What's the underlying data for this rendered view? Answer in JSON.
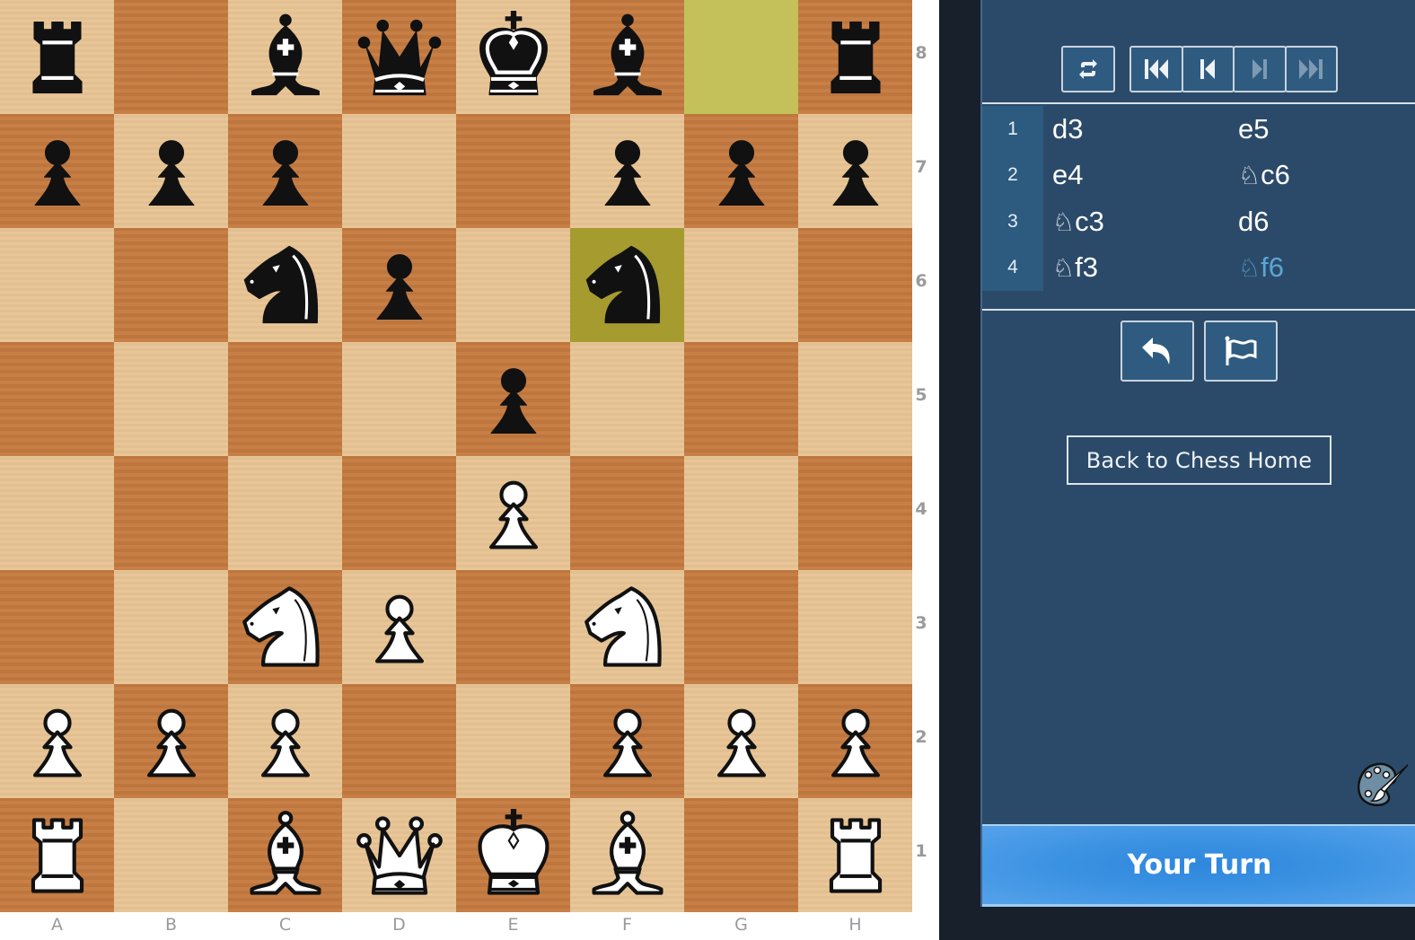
{
  "board": {
    "orientation": "white-bottom",
    "files": [
      "A",
      "B",
      "C",
      "D",
      "E",
      "F",
      "G",
      "H"
    ],
    "ranks": [
      "8",
      "7",
      "6",
      "5",
      "4",
      "3",
      "2",
      "1"
    ],
    "colors": {
      "light": "#e7c393",
      "dark": "#c57b40",
      "highlight_light": "#c4c15b",
      "highlight_dark": "#a59b2f"
    },
    "highlighted_squares": [
      "g8",
      "f6"
    ],
    "position": [
      [
        "bR",
        "",
        "bB",
        "bQ",
        "bK",
        "bB",
        "",
        "bR"
      ],
      [
        "bP",
        "bP",
        "bP",
        "",
        "",
        "bP",
        "bP",
        "bP"
      ],
      [
        "",
        "",
        "bN",
        "bP",
        "",
        "bN",
        "",
        ""
      ],
      [
        "",
        "",
        "",
        "",
        "bP",
        "",
        "",
        ""
      ],
      [
        "",
        "",
        "",
        "",
        "wP",
        "",
        "",
        ""
      ],
      [
        "",
        "",
        "wN",
        "wP",
        "",
        "wN",
        "",
        ""
      ],
      [
        "wP",
        "wP",
        "wP",
        "",
        "",
        "wP",
        "wP",
        "wP"
      ],
      [
        "wR",
        "",
        "wB",
        "wQ",
        "wK",
        "wB",
        "",
        "wR"
      ]
    ]
  },
  "panel": {
    "controls": {
      "flip_icon": "flip-board-icon",
      "nav": [
        {
          "name": "first-move",
          "icon": "skip-to-start-icon",
          "enabled": true
        },
        {
          "name": "previous-move",
          "icon": "step-back-icon",
          "enabled": true
        },
        {
          "name": "next-move",
          "icon": "step-forward-icon",
          "enabled": false
        },
        {
          "name": "last-move",
          "icon": "skip-to-end-icon",
          "enabled": false
        }
      ]
    },
    "moves": [
      {
        "num": "1",
        "white": {
          "piece": "",
          "sq": "d3"
        },
        "black": {
          "piece": "",
          "sq": "e5"
        }
      },
      {
        "num": "2",
        "white": {
          "piece": "",
          "sq": "e4"
        },
        "black": {
          "piece": "♘",
          "sq": "c6"
        }
      },
      {
        "num": "3",
        "white": {
          "piece": "♘",
          "sq": "c3"
        },
        "black": {
          "piece": "",
          "sq": "d6"
        }
      },
      {
        "num": "4",
        "white": {
          "piece": "♘",
          "sq": "f3"
        },
        "black": {
          "piece": "♘",
          "sq": "f6"
        }
      }
    ],
    "current_move": "4b",
    "actions": {
      "undo_icon": "undo-icon",
      "resign_icon": "flag-icon"
    },
    "home_button": "Back to Chess Home",
    "theme_icon": "palette-icon",
    "turn_status": "Your Turn",
    "accent": "#5ba5d4"
  }
}
